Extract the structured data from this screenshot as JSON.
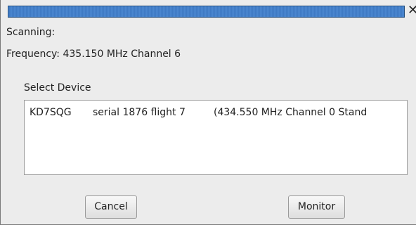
{
  "progress": {
    "fraction": 1.0
  },
  "window": {
    "close_glyph": "✕"
  },
  "status": {
    "scanning_label": "Scanning:",
    "frequency_text": "Frequency: 435.150 MHz Channel 6"
  },
  "device_list": {
    "label": "Select Device",
    "items": [
      {
        "callsign": "KD7SQG",
        "serial_flight": "serial 1876 flight 7",
        "detail": "(434.550 MHz Channel 0 Stand"
      }
    ]
  },
  "buttons": {
    "cancel_label": "Cancel",
    "monitor_label": "Monitor"
  },
  "colors": {
    "progress_fill": "#4a86cf",
    "background": "#ececec"
  }
}
